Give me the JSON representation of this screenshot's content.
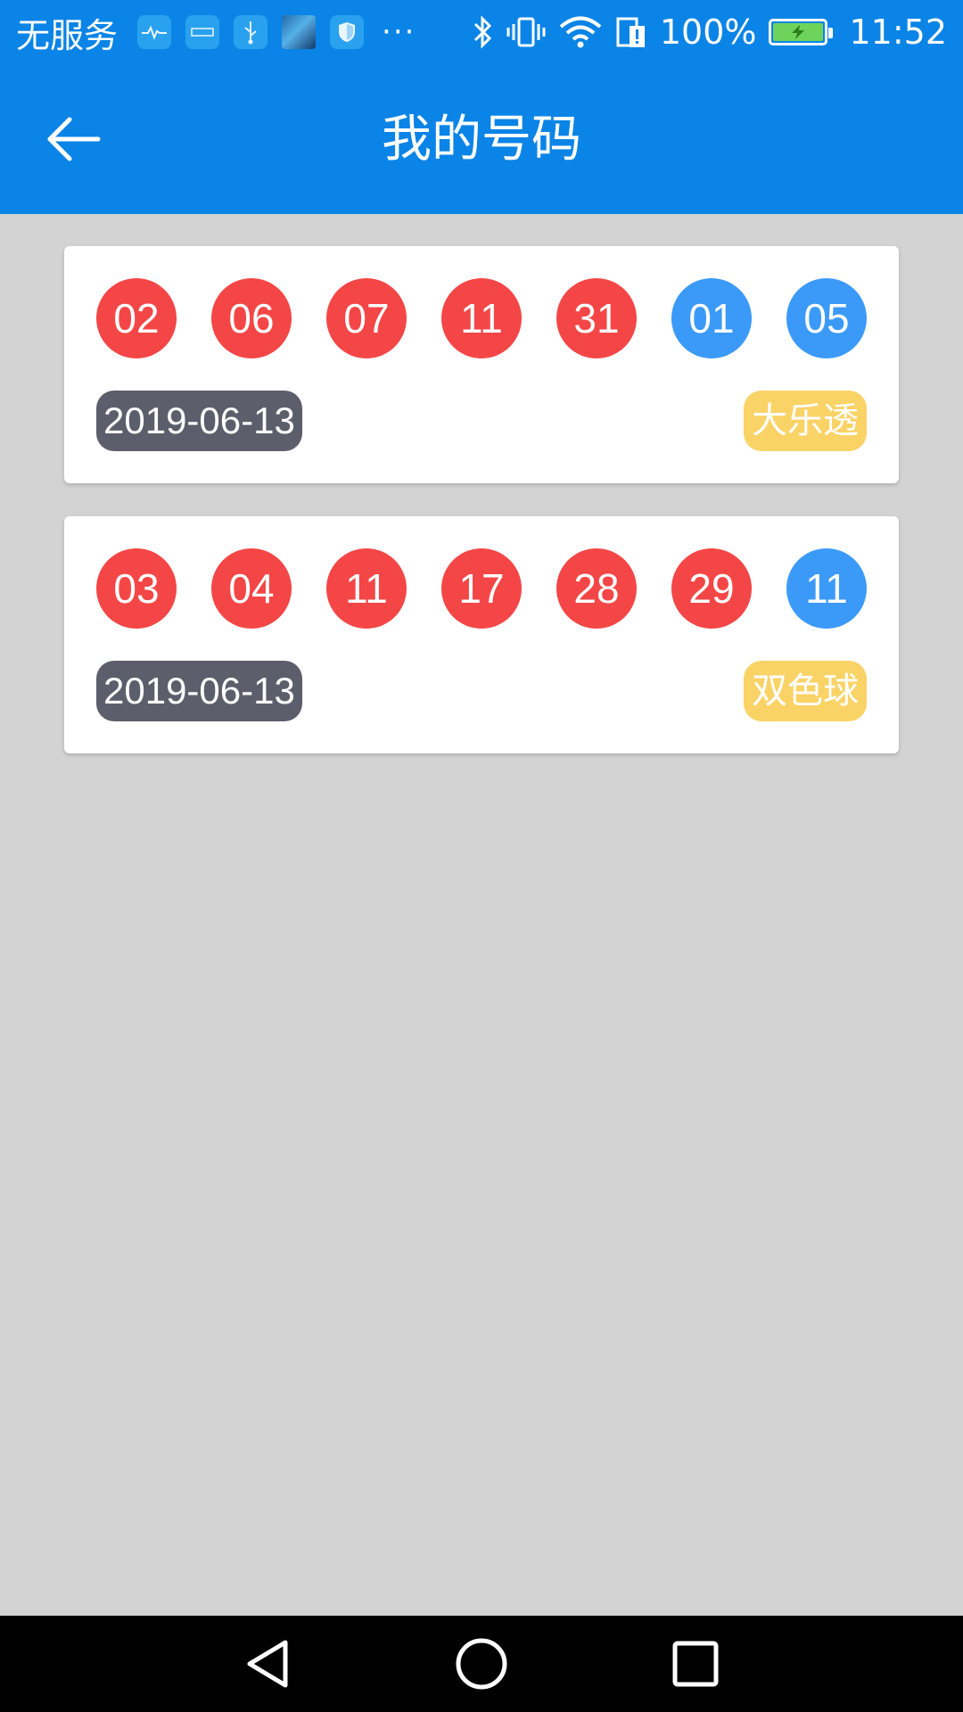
{
  "status_bar": {
    "carrier": "无服务",
    "notification_icons": [
      "health-icon",
      "app-icon",
      "usb-icon",
      "photo-icon",
      "shield-icon"
    ],
    "more": "···",
    "battery": "100%",
    "time": "11:52"
  },
  "app_bar": {
    "title": "我的号码"
  },
  "tickets": [
    {
      "red_balls": [
        "02",
        "06",
        "07",
        "11",
        "31"
      ],
      "blue_balls": [
        "01",
        "05"
      ],
      "date": "2019-06-13",
      "type": "大乐透"
    },
    {
      "red_balls": [
        "03",
        "04",
        "11",
        "17",
        "28",
        "29"
      ],
      "blue_balls": [
        "11"
      ],
      "date": "2019-06-13",
      "type": "双色球"
    }
  ],
  "colors": {
    "primary": "#0a84e6",
    "red_ball": "#f44646",
    "blue_ball": "#3b9af8",
    "date_badge": "#5d5e6b",
    "type_badge": "#fad367",
    "background": "#d3d3d3"
  },
  "nav_bar": {
    "icons": [
      "back-triangle-icon",
      "home-circle-icon",
      "recents-square-icon"
    ]
  }
}
